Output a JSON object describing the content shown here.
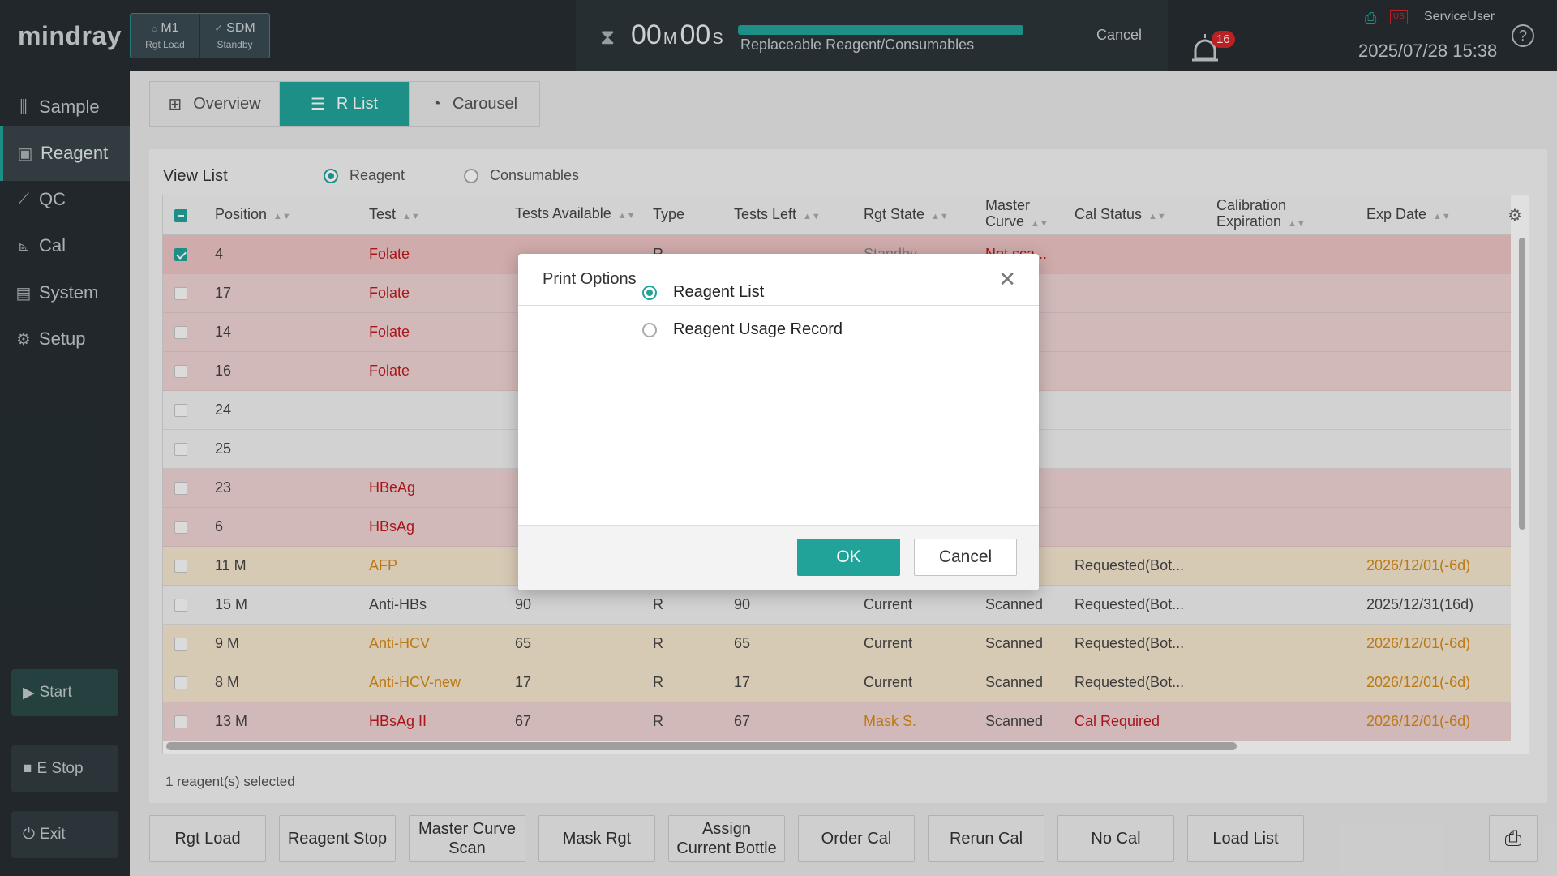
{
  "brand": {
    "logo": "mindray"
  },
  "modules": [
    {
      "name": "M1",
      "state": "Rgt Load"
    },
    {
      "name": "SDM",
      "state": "Standby"
    }
  ],
  "timer": {
    "minutes": "00",
    "seconds": "00",
    "min_unit": "M",
    "sec_unit": "S"
  },
  "progress": {
    "label": "Replaceable Reagent/Consumables",
    "fraction": 1.0
  },
  "top_cancel": "Cancel",
  "alarm": {
    "count": "16",
    "badge_color": "#d3262b"
  },
  "user": "ServiceUser",
  "datetime": "2025/07/28 15:38",
  "help": "?",
  "sidebar": {
    "items": [
      {
        "label": "Sample",
        "icon": "sample-rack-icon"
      },
      {
        "label": "Reagent",
        "icon": "reagent-bottle-icon"
      },
      {
        "label": "QC",
        "icon": "qc-chart-icon"
      },
      {
        "label": "Cal",
        "icon": "cal-chart-icon"
      },
      {
        "label": "System",
        "icon": "system-icon"
      },
      {
        "label": "Setup",
        "icon": "gear-icon"
      }
    ],
    "start": "Start",
    "estop": "E Stop",
    "exit": "Exit"
  },
  "view_tabs": [
    "Overview",
    "R List",
    "Carousel"
  ],
  "view_list": {
    "label": "View List",
    "options": [
      "Reagent",
      "Consumables"
    ]
  },
  "table": {
    "columns": [
      "Position",
      "Test",
      "Tests Available",
      "Type",
      "Tests Left",
      "Rgt State",
      "Master Curve",
      "Cal Status",
      "Calibration Expiration",
      "Exp Date"
    ],
    "rows": [
      {
        "checked": true,
        "style": "red",
        "testcolor": "red",
        "cells": [
          "4",
          "Folate",
          "",
          "R",
          "",
          "Standby",
          "Not sca...",
          "",
          "",
          ""
        ]
      },
      {
        "checked": false,
        "style": "red",
        "testcolor": "red",
        "cells": [
          "17",
          "Folate",
          "",
          "",
          "",
          "",
          "...",
          "",
          "",
          ""
        ]
      },
      {
        "checked": false,
        "style": "red",
        "testcolor": "red",
        "cells": [
          "14",
          "Folate",
          "",
          "",
          "",
          "",
          "...",
          "",
          "",
          ""
        ]
      },
      {
        "checked": false,
        "style": "red",
        "testcolor": "red",
        "cells": [
          "16",
          "Folate",
          "",
          "",
          "",
          "",
          "...",
          "",
          "",
          ""
        ]
      },
      {
        "checked": false,
        "style": "grey",
        "testcolor": "gray",
        "cells": [
          "24",
          "",
          "",
          "",
          "",
          "",
          "",
          "",
          "",
          ""
        ]
      },
      {
        "checked": false,
        "style": "grey",
        "testcolor": "gray",
        "cells": [
          "25",
          "",
          "",
          "",
          "",
          "",
          "",
          "",
          "",
          ""
        ]
      },
      {
        "checked": false,
        "style": "red",
        "testcolor": "red",
        "cells": [
          "23",
          "HBeAg",
          "",
          "",
          "",
          "",
          "...",
          "",
          "",
          ""
        ]
      },
      {
        "checked": false,
        "style": "red",
        "testcolor": "red",
        "cells": [
          "6",
          "HBsAg",
          "",
          "",
          "",
          "",
          "...",
          "",
          "",
          ""
        ]
      },
      {
        "checked": false,
        "style": "orange",
        "testcolor": "org",
        "cells": [
          "11 M",
          "AFP",
          "",
          "",
          "",
          "",
          "d",
          "Requested(Bot...",
          "",
          "2026/12/01(-6d)"
        ]
      },
      {
        "checked": false,
        "style": "grey",
        "testcolor": "gray",
        "cells": [
          "15 M",
          "Anti-HBs",
          "90",
          "R",
          "90",
          "Current",
          "Scanned",
          "Requested(Bot...",
          "",
          "2025/12/31(16d)"
        ]
      },
      {
        "checked": false,
        "style": "orange",
        "testcolor": "org",
        "cells": [
          "9 M",
          "Anti-HCV",
          "65",
          "R",
          "65",
          "Current",
          "Scanned",
          "Requested(Bot...",
          "",
          "2026/12/01(-6d)"
        ]
      },
      {
        "checked": false,
        "style": "orange",
        "testcolor": "org",
        "cells": [
          "8 M",
          "Anti-HCV-new",
          "17",
          "R",
          "17",
          "Current",
          "Scanned",
          "Requested(Bot...",
          "",
          "2026/12/01(-6d)"
        ]
      },
      {
        "checked": false,
        "style": "red",
        "testcolor": "red",
        "cells": [
          "13 M",
          "HBsAg II",
          "67",
          "R",
          "67",
          "Mask S.",
          "Scanned",
          "Cal Required",
          "",
          "2026/12/01(-6d)"
        ]
      }
    ]
  },
  "selected_count": "1 reagent(s) selected",
  "bottom_buttons": [
    "Rgt Load",
    "Reagent Stop",
    "Master Curve Scan",
    "Mask  Rgt",
    "Assign Current Bottle",
    "Order Cal",
    "Rerun Cal",
    "No Cal",
    "Load List"
  ],
  "dialog": {
    "title": "Print Options",
    "options": [
      "Reagent List",
      "Reagent Usage Record"
    ],
    "selected": 0,
    "ok": "OK",
    "cancel": "Cancel"
  },
  "colors": {
    "accent": "#22a39a",
    "alert_red": "#c0181e",
    "warn_orange": "#d78a16"
  }
}
